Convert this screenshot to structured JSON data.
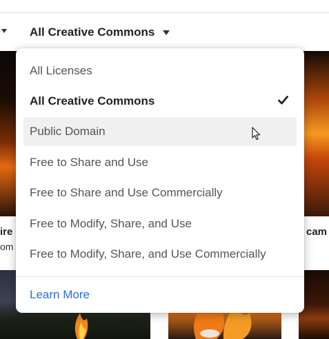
{
  "filter": {
    "license_label": "All Creative Commons"
  },
  "menu": {
    "items": [
      {
        "label": "All Licenses"
      },
      {
        "label": "All Creative Commons"
      },
      {
        "label": "Public Domain"
      },
      {
        "label": "Free to Share and Use"
      },
      {
        "label": "Free to Share and Use Commercially"
      },
      {
        "label": "Free to Modify, Share, and Use"
      },
      {
        "label": "Free to Modify, Share, and Use Commercially"
      }
    ],
    "selected_item": "All Creative Commons",
    "hovered_item": "Public Domain",
    "learn_more": "Learn More"
  },
  "results": {
    "left_title_fragment": "ire",
    "left_subtitle_fragment": "om",
    "right_title_fragment": "cam"
  },
  "icons": [
    "caret-down-icon",
    "checkmark-icon",
    "mouse-pointer-icon"
  ],
  "colors": {
    "link": "#2b6dd6",
    "hover_bg": "#f0f0f0"
  }
}
